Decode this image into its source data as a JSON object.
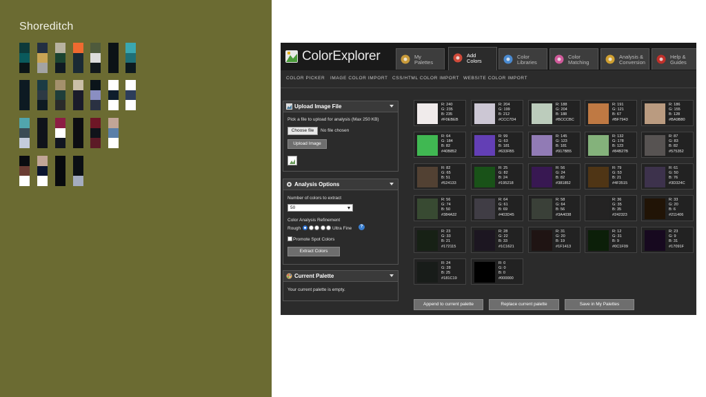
{
  "left_panel": {
    "title": "Shoreditch",
    "strips": [
      [
        "#0d3a3a",
        "#0a5a5c",
        "#0b1517"
      ],
      [
        "#222f42",
        "#c8a455",
        "#a3a3a3"
      ],
      [
        "#b8b2a0",
        "#1b4330",
        "#101a22"
      ],
      [
        "#f06a30",
        "#1a2a34",
        "#1a2a34"
      ],
      [
        "#4e5a3c",
        "#dcdcdc",
        "#11181c"
      ],
      [
        "#0b1216",
        "#0b1216",
        "#0b1216"
      ],
      [
        "#3aa7b0",
        "#1f6f76",
        "#0d1a1f"
      ],
      [
        "#0d1a22",
        "#0d1a22",
        "#0d1a22"
      ],
      [
        "#1b3b44",
        "#2d3a44",
        "#0e1b22"
      ],
      [
        "#a4906c",
        "#1f3e3a",
        "#2a2b2a"
      ],
      [
        "#cbbfa8",
        "#1a1b2a",
        "#1a1b2a"
      ],
      [
        "#0b141a",
        "#8a8ec2",
        "#2a3142"
      ],
      [
        "#ffffff",
        "#0e1d2c",
        "#ffffff"
      ],
      [
        "#ffffff",
        "#2d3d5a",
        "#ffffff"
      ],
      [
        "#51a5ad",
        "#3b4b55",
        "#c4ccdc"
      ],
      [
        "#10131a",
        "#10131a",
        "#10131a"
      ],
      [
        "#8c1d44",
        "#ffffff",
        "#111520"
      ],
      [
        "#0c0d12",
        "#0c0d12",
        "#0c0d12"
      ],
      [
        "#6e1626",
        "#10131a",
        "#5c1a26"
      ],
      [
        "#c1a597",
        "#5a7fa8",
        "#ffffff"
      ],
      [
        "#0a0c10",
        "#6a3c33",
        "#ffffff"
      ],
      [
        "#c1a597",
        "#0b1530",
        "#ffffff"
      ],
      [
        "#080a0e",
        "#080a0e",
        "#080a0e"
      ],
      [
        "#0b0f14",
        "#0b0f14",
        "#a4acc0"
      ]
    ]
  },
  "app": {
    "logo_text": "ColorExplorer",
    "tabs": [
      {
        "line1": "My",
        "line2": "Palettes",
        "active": false
      },
      {
        "line1": "Add",
        "line2": "Colors",
        "active": true
      },
      {
        "line1": "Color",
        "line2": "Libraries",
        "active": false
      },
      {
        "line1": "Color",
        "line2": "Matching",
        "active": false
      },
      {
        "line1": "Analysis &",
        "line2": "Conversion",
        "active": false
      },
      {
        "line1": "Help &",
        "line2": "Guides",
        "active": false
      }
    ],
    "subnav": [
      "COLOR PICKER",
      "IMAGE COLOR IMPORT",
      "CSS/HTML COLOR IMPORT",
      "WEBSITE COLOR IMPORT"
    ],
    "upload": {
      "title": "Upload Image File",
      "instructions": "Pick a file to upload for analysis (Max 250 KB)",
      "choose_label": "Choose file",
      "no_file": "No file chosen",
      "upload_button": "Upload Image"
    },
    "analysis": {
      "title": "Analysis Options",
      "colors_label": "Number of colors to extract",
      "colors_value": "50",
      "refinement_label": "Color Analysis Refinement",
      "rough": "Rough",
      "ultra": "Ultra Fine",
      "promote": "Promote Spot Colors",
      "extract_button": "Extract Colors"
    },
    "palette": {
      "title": "Current Palette",
      "empty": "Your current palette is empty."
    },
    "swatches": [
      {
        "hex": "#F0EBEB",
        "r": 240,
        "g": 235,
        "b": 235
      },
      {
        "hex": "#CCC7D4",
        "r": 204,
        "g": 199,
        "b": 212
      },
      {
        "hex": "#BCCCBC",
        "r": 188,
        "g": 204,
        "b": 188
      },
      {
        "hex": "#BF7943",
        "r": 191,
        "g": 121,
        "b": 67
      },
      {
        "hex": "#BA9B80",
        "r": 186,
        "g": 155,
        "b": 128
      },
      {
        "hex": "#40B852",
        "r": 64,
        "g": 184,
        "b": 82
      },
      {
        "hex": "#633FB5",
        "r": 99,
        "g": 63,
        "b": 181
      },
      {
        "hex": "#917BB5",
        "r": 145,
        "g": 123,
        "b": 181
      },
      {
        "hex": "#84B27B",
        "r": 132,
        "g": 178,
        "b": 123
      },
      {
        "hex": "#575352",
        "r": 87,
        "g": 83,
        "b": 82
      },
      {
        "hex": "#524133",
        "r": 82,
        "g": 65,
        "b": 51
      },
      {
        "hex": "#195218",
        "r": 25,
        "g": 82,
        "b": 24
      },
      {
        "hex": "#381852",
        "r": 56,
        "g": 24,
        "b": 82
      },
      {
        "hex": "#4F3515",
        "r": 79,
        "g": 53,
        "b": 21
      },
      {
        "hex": "#3D324C",
        "r": 61,
        "g": 50,
        "b": 76
      },
      {
        "hex": "#384A32",
        "r": 56,
        "g": 74,
        "b": 50
      },
      {
        "hex": "#403D45",
        "r": 64,
        "g": 61,
        "b": 69
      },
      {
        "hex": "#3A4038",
        "r": 58,
        "g": 64,
        "b": 56
      },
      {
        "hex": "#242323",
        "r": 36,
        "g": 35,
        "b": 35
      },
      {
        "hex": "#211406",
        "r": 33,
        "g": 20,
        "b": 6
      },
      {
        "hex": "#172115",
        "r": 23,
        "g": 33,
        "b": 21
      },
      {
        "hex": "#1C1621",
        "r": 28,
        "g": 22,
        "b": 33
      },
      {
        "hex": "#1F1413",
        "r": 31,
        "g": 20,
        "b": 19
      },
      {
        "hex": "#0C1F09",
        "r": 12,
        "g": 31,
        "b": 9
      },
      {
        "hex": "#17091F",
        "r": 23,
        "g": 9,
        "b": 31
      },
      {
        "hex": "#181C19",
        "r": 24,
        "g": 28,
        "b": 25
      },
      {
        "hex": "#000000",
        "r": 0,
        "g": 0,
        "b": 0
      }
    ],
    "bottom_buttons": [
      "Append to current palette",
      "Replace current palette",
      "Save in My Palettes"
    ]
  }
}
